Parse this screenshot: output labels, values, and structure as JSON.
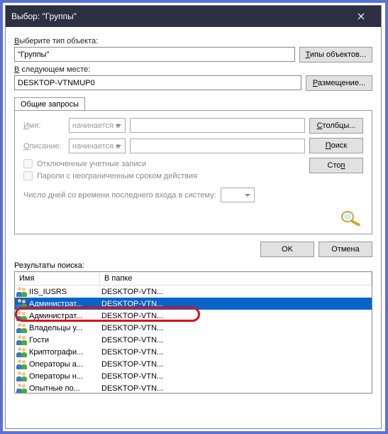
{
  "window": {
    "title": "Выбор: \"Группы\""
  },
  "labels": {
    "object_type": "Выберите тип объекта:",
    "location": "В следующем месте:",
    "results": "Результаты поиска:"
  },
  "underlines": {
    "v": "В",
    "result_n": "Н"
  },
  "object_type_value": "\"Группы\"",
  "location_value": "DESKTOP-VTNMUP0",
  "buttons": {
    "object_types": "Типы объектов...",
    "placement": "Размещение...",
    "columns": "Столбцы...",
    "search": "Поиск",
    "stop": "Стоп",
    "ok": "OK",
    "cancel": "Отмена"
  },
  "underline_letters": {
    "object_types": "Т",
    "placement": "Р",
    "columns": "С",
    "search": "П",
    "stop": "С",
    "cancel": "О"
  },
  "tab": {
    "label": "Общие запросы"
  },
  "form": {
    "name_label": "Имя:",
    "name_u": "И",
    "desc_label": "Описание:",
    "desc_u": "О",
    "starts_with": "начинается с",
    "disabled_accounts": "Отключенные учетные записи",
    "unlimited_passwords": "Пароли с неограниченным сроком действия",
    "days_label": "Число дней со времени последнего входа в систему:"
  },
  "columns": {
    "name": "Имя",
    "folder": "В папке"
  },
  "rows": [
    {
      "name": "IIS_IUSRS",
      "folder": "DESKTOP-VTN...",
      "selected": false
    },
    {
      "name": "Администрат...",
      "folder": "DESKTOP-VTN...",
      "selected": true
    },
    {
      "name": "Администрат...",
      "folder": "DESKTOP-VTN...",
      "selected": false
    },
    {
      "name": "Владельцы у...",
      "folder": "DESKTOP-VTN...",
      "selected": false
    },
    {
      "name": "Гости",
      "folder": "DESKTOP-VTN...",
      "selected": false
    },
    {
      "name": "Криптографи...",
      "folder": "DESKTOP-VTN...",
      "selected": false
    },
    {
      "name": "Операторы а...",
      "folder": "DESKTOP-VTN...",
      "selected": false
    },
    {
      "name": "Операторы н...",
      "folder": "DESKTOP-VTN...",
      "selected": false
    },
    {
      "name": "Опытные по...",
      "folder": "DESKTOP-VTN...",
      "selected": false
    }
  ]
}
